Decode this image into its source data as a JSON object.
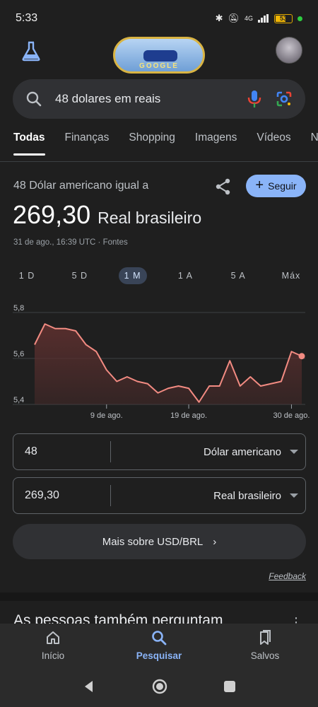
{
  "status": {
    "time": "5:33",
    "network": "4G",
    "battery": "53"
  },
  "doodle": {
    "word": "GOOGLE"
  },
  "search": {
    "query": "48 dolares em reais"
  },
  "tabs": [
    "Todas",
    "Finanças",
    "Shopping",
    "Imagens",
    "Vídeos",
    "No"
  ],
  "converter": {
    "heading": "48 Dólar americano igual a",
    "follow_label": "Seguir",
    "result_value": "269,30",
    "result_currency": "Real brasileiro",
    "timestamp": "31 de ago., 16:39 UTC · Fontes",
    "ranges": [
      "1 D",
      "5 D",
      "1 M",
      "1 A",
      "5 A",
      "Máx"
    ],
    "active_range": "1 M",
    "from_amount": "48",
    "from_currency": "Dólar americano",
    "to_amount": "269,30",
    "to_currency": "Real brasileiro",
    "more_label": "Mais sobre USD/BRL",
    "feedback": "Feedback"
  },
  "chart_data": {
    "type": "area",
    "x": [
      "1 de ago.",
      "2 de ago.",
      "3 de ago.",
      "5 de ago.",
      "6 de ago.",
      "7 de ago.",
      "8 de ago.",
      "9 de ago.",
      "10 de ago.",
      "12 de ago.",
      "13 de ago.",
      "14 de ago.",
      "15 de ago.",
      "16 de ago.",
      "17 de ago.",
      "19 de ago.",
      "20 de ago.",
      "21 de ago.",
      "22 de ago.",
      "23 de ago.",
      "24 de ago.",
      "26 de ago.",
      "27 de ago.",
      "28 de ago.",
      "29 de ago.",
      "30 de ago.",
      "31 de ago."
    ],
    "values": [
      5.66,
      5.75,
      5.73,
      5.73,
      5.72,
      5.66,
      5.63,
      5.55,
      5.5,
      5.52,
      5.5,
      5.49,
      5.45,
      5.47,
      5.48,
      5.47,
      5.41,
      5.48,
      5.48,
      5.59,
      5.48,
      5.52,
      5.48,
      5.49,
      5.5,
      5.63,
      5.61
    ],
    "y_ticks": [
      "5,8",
      "5,6",
      "5,4"
    ],
    "x_ticks": [
      "9 de ago.",
      "19 de ago.",
      "30 de ago."
    ],
    "ylim": [
      5.4,
      5.8
    ],
    "grid": true,
    "line_color": "#f28b82",
    "fill_color": "#5a2f2e"
  },
  "bottom_nav": [
    {
      "label": "Início",
      "icon": "home-icon"
    },
    {
      "label": "Pesquisar",
      "icon": "search-icon"
    },
    {
      "label": "Salvos",
      "icon": "bookmarks-icon"
    }
  ],
  "people_also_ask": "As pessoas também perguntam"
}
